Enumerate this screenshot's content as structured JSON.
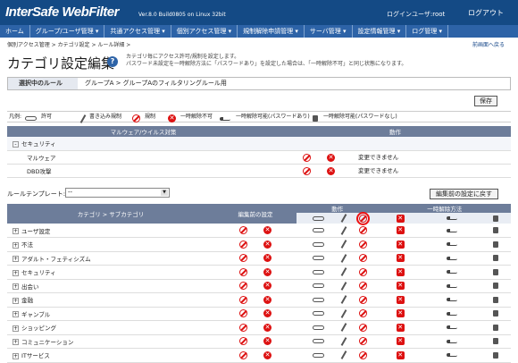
{
  "header": {
    "logo": "InterSafe WebFilter",
    "version": "Ver.8.0 Build0805 on Linux 32bit",
    "login_user": "ログインユーザ:root",
    "logout": "ログアウト"
  },
  "nav": [
    "ホーム",
    "グループ/ユーザ管理 ▾",
    "共通アクセス管理 ▾",
    "個別アクセス管理 ▾",
    "規制解除申請管理 ▾",
    "サーバ管理 ▾",
    "設定情報管理 ▾",
    "ログ管理 ▾"
  ],
  "breadcrumb": "個別アクセス管理 > カテゴリ設定 > ルール詳細 >",
  "to_check": "前画面へ戻る",
  "page_title": "カテゴリ設定編集",
  "description": [
    "カテゴリ毎にアクセス許可/規制を設定します。",
    "パスワード未設定を一時解除方法に「パスワードあり」を設定した場合は、「一時解除不可」と同じ状態になります。"
  ],
  "rule": {
    "label": "選択中のルール",
    "value": "グループA > グループAのフィルタリングルール用"
  },
  "save_label": "保存",
  "legend": {
    "title": "凡例:",
    "allow": "許可",
    "write": "書き込み規制",
    "block": "規制",
    "temp_off": "一時解除不可",
    "temp_pw": "一時解除可能(パスワードあり)",
    "temp_nopw": "一時解除可能(パスワードなし)"
  },
  "malware": {
    "col1": "マルウェア/ウイルス対策",
    "col2": "動作",
    "group": "セキュリティ",
    "rows": [
      {
        "name": "マルウェア",
        "status": "変更できません"
      },
      {
        "name": "DBD攻撃",
        "status": "変更できません"
      }
    ]
  },
  "template": {
    "label": "ルールテンプレート:",
    "value": "--"
  },
  "reset_label": "編集前の設定に戻す",
  "cat_table": {
    "col_cat": "カテゴリ > サブカテゴリ",
    "col_before": "編集前の設定",
    "col_action": "動作",
    "col_temp": "一時解除方法",
    "rows": [
      "ユーザ設定",
      "不法",
      "アダルト・フェティシズム",
      "セキュリティ",
      "出会い",
      "金融",
      "ギャンブル",
      "ショッピング",
      "コミュニケーション",
      "ITサービス"
    ]
  }
}
